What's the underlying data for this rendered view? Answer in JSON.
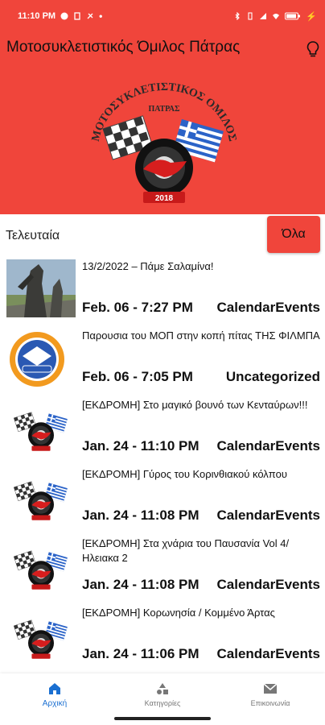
{
  "status_bar": {
    "time": "11:10 PM",
    "battery": "",
    "colors": {
      "background": "#f0453b",
      "text": "#ffffff"
    }
  },
  "header": {
    "title": "Μοτοσυκλετιστικός Όμιλος Πάτρας",
    "icon": "lightbulb-icon",
    "logo": {
      "arc_text": "ΜΟΤΟΣΥΚΛΕΤΙΣΤΙΚΟΣ ΟΜΙΛΟΣ",
      "city": "ΠΑΤΡΑΣ",
      "year": "2018"
    },
    "colors": {
      "background": "#f0453b"
    }
  },
  "section": {
    "title": "Τελευταία",
    "all_button_label": "Όλα"
  },
  "posts": [
    {
      "title": "13/2/2022 – Πάμε Σαλαμίνα!",
      "date": "Feb. 06 - 7:27 PM",
      "category": "CalendarEvents",
      "thumb": "statue-photo"
    },
    {
      "title": "Παρουσια του ΜΟΠ στην κοπή πίτας ΤΗΣ ΦΙΛΜΠΑ",
      "date": "Feb. 06 - 7:05 PM",
      "category": "Uncategorized",
      "thumb": "filmpa-logo"
    },
    {
      "title": "[ΕΚΔΡΟΜΗ] Στο μαγικό βουνό των Κενταύρων!!!",
      "date": "Jan. 24 - 11:10 PM",
      "category": "CalendarEvents",
      "thumb": "club-logo"
    },
    {
      "title": "[ΕΚΔΡΟΜΗ] Γύρος του Κορινθιακού κόλπου",
      "date": "Jan. 24 - 11:08 PM",
      "category": "CalendarEvents",
      "thumb": "club-logo"
    },
    {
      "title": "[ΕΚΔΡΟΜΗ] Στα χνάρια του Παυσανία Vol 4/ Ηλειακα 2",
      "date": "Jan. 24 - 11:08 PM",
      "category": "CalendarEvents",
      "thumb": "club-logo"
    },
    {
      "title": "[ΕΚΔΡΟΜΗ] Κορωνησία / Κομμένο Άρτας",
      "date": "Jan. 24 - 11:06 PM",
      "category": "CalendarEvents",
      "thumb": "club-logo"
    }
  ],
  "bottom_nav": {
    "items": [
      {
        "label": "Αρχική",
        "icon": "home-icon",
        "active": true
      },
      {
        "label": "Κατηγορίες",
        "icon": "categories-icon",
        "active": false
      },
      {
        "label": "Επικοινωνία",
        "icon": "mail-icon",
        "active": false
      }
    ],
    "colors": {
      "active": "#1a6fd1",
      "inactive": "#777777"
    }
  }
}
